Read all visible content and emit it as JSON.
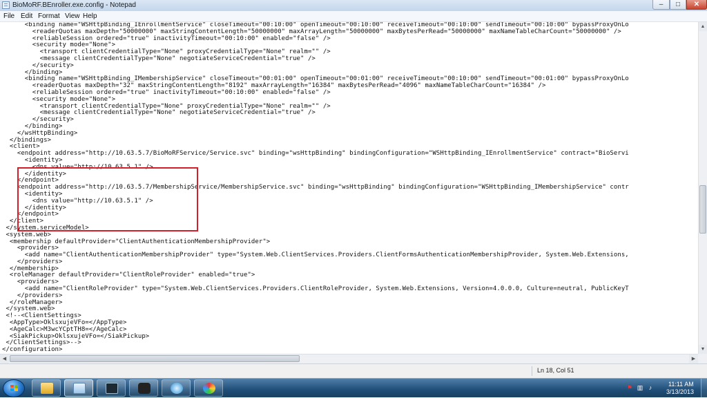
{
  "window": {
    "title": "BioMoRF.BEnroller.exe.config - Notepad",
    "buttons": {
      "minimize": "–",
      "maximize": "□",
      "close": "✕"
    }
  },
  "menu": {
    "items": [
      "File",
      "Edit",
      "Format",
      "View",
      "Help"
    ]
  },
  "editor": {
    "content": "      <binding name=\"WSHttpBinding_IEnrollmentService\" closeTimeout=\"00:10:00\" openTimeout=\"00:10:00\" receiveTimeout=\"00:10:00\" sendTimeout=\"00:10:00\" bypassProxyOnLo\n        <readerQuotas maxDepth=\"50000000\" maxStringContentLength=\"50000000\" maxArrayLength=\"50000000\" maxBytesPerRead=\"50000000\" maxNameTableCharCount=\"50000000\" />\n        <reliableSession ordered=\"true\" inactivityTimeout=\"00:10:00\" enabled=\"false\" />\n        <security mode=\"None\">\n          <transport clientCredentialType=\"None\" proxyCredentialType=\"None\" realm=\"\" />\n          <message clientCredentialType=\"None\" negotiateServiceCredential=\"true\" />\n        </security>\n      </binding>\n      <binding name=\"WSHttpBinding_IMembershipService\" closeTimeout=\"00:01:00\" openTimeout=\"00:01:00\" receiveTimeout=\"00:10:00\" sendTimeout=\"00:01:00\" bypassProxyOnLo\n        <readerQuotas maxDepth=\"32\" maxStringContentLength=\"8192\" maxArrayLength=\"16384\" maxBytesPerRead=\"4096\" maxNameTableCharCount=\"16384\" />\n        <reliableSession ordered=\"true\" inactivityTimeout=\"00:10:00\" enabled=\"false\" />\n        <security mode=\"None\">\n          <transport clientCredentialType=\"None\" proxyCredentialType=\"None\" realm=\"\" />\n          <message clientCredentialType=\"None\" negotiateServiceCredential=\"true\" />\n        </security>\n      </binding>\n    </wsHttpBinding>\n  </bindings>\n  <client>\n    <endpoint address=\"http://10.63.5.7/BioMoRFService/Service.svc\" binding=\"wsHttpBinding\" bindingConfiguration=\"WSHttpBinding_IEnrollmentService\" contract=\"BioServi\n      <identity>\n        <dns value=\"http://10.63.5.1\" />\n      </identity>\n    </endpoint>\n    <endpoint address=\"http://10.63.5.7/MembershipService/MembershipService.svc\" binding=\"wsHttpBinding\" bindingConfiguration=\"WSHttpBinding_IMembershipService\" contr\n      <identity>\n        <dns value=\"http://10.63.5.1\" />\n      </identity>\n    </endpoint>\n  </client>\n </system.serviceModel>\n <system.web>\n  <membership defaultProvider=\"ClientAuthenticationMembershipProvider\">\n    <providers>\n      <add name=\"ClientAuthenticationMembershipProvider\" type=\"System.Web.ClientServices.Providers.ClientFormsAuthenticationMembershipProvider, System.Web.Extensions,\n    </providers>\n  </membership>\n  <roleManager defaultProvider=\"ClientRoleProvider\" enabled=\"true\">\n    <providers>\n      <add name=\"ClientRoleProvider\" type=\"System.Web.ClientServices.Providers.ClientRoleProvider, System.Web.Extensions, Version=4.0.0.0, Culture=neutral, PublicKeyT\n    </providers>\n  </roleManager>\n </system.web>\n <!--<ClientSettings>\n  <AppType>OklsxujeVFo=</AppType>\n  <AgeCalc>M3wcYCptTH8=</AgeCalc>\n  <SiakPickup>OklsxujeVFo=</SiakPickup>\n </ClientSettings>-->\n</configuration>"
  },
  "status": {
    "position": "Ln 18, Col 51"
  },
  "taskbar": {
    "apps": [
      "explorer-icon",
      "notepad-icon",
      "task-manager-icon",
      "camera-icon",
      "fingerprint-icon",
      "paint-icon"
    ],
    "tray_icons": [
      "flag-icon",
      "network-icon",
      "volume-icon"
    ],
    "time": "11:11 AM",
    "date": "3/13/2013"
  }
}
